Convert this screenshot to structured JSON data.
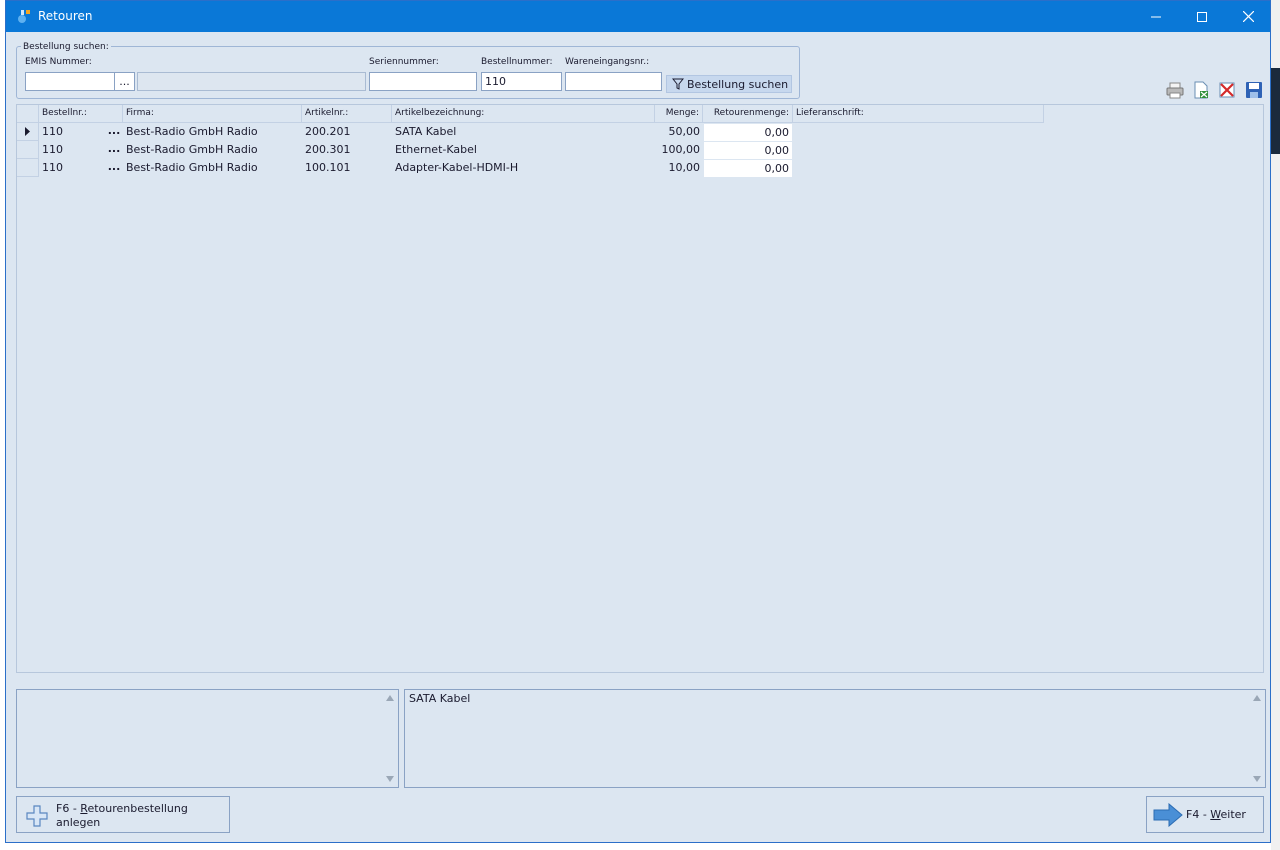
{
  "window": {
    "title": "Retouren"
  },
  "search": {
    "group_label": "Bestellung suchen:",
    "emis_label": "EMIS Nummer:",
    "emis_value": "",
    "emis_dots": "...",
    "serial_label": "Seriennummer:",
    "serial_value": "",
    "order_label": "Bestellnummer:",
    "order_value": "110",
    "goods_label": "Wareneingangsnr.:",
    "goods_value": "",
    "search_button": "Bestellung suchen"
  },
  "toolbar": {
    "icons": [
      "print-icon",
      "excel-export-icon",
      "delete-icon",
      "save-icon"
    ]
  },
  "grid": {
    "headers": {
      "order_no": "Bestellnr.:",
      "company": "Firma:",
      "article_no": "Artikelnr.:",
      "article_desc": "Artikelbezeichnung:",
      "quantity": "Menge:",
      "return_qty": "Retourenmenge:",
      "delivery": "Lieferanschrift:"
    },
    "rows": [
      {
        "order_no": "110",
        "dots": "...",
        "company": "Best-Radio GmbH Radio",
        "article_no": "200.201",
        "article_desc": "SATA Kabel",
        "quantity": "50,00",
        "return_qty": "0,00",
        "delivery": ""
      },
      {
        "order_no": "110",
        "dots": "...",
        "company": "Best-Radio GmbH Radio",
        "article_no": "200.301",
        "article_desc": "Ethernet-Kabel",
        "quantity": "100,00",
        "return_qty": "0,00",
        "delivery": ""
      },
      {
        "order_no": "110",
        "dots": "...",
        "company": "Best-Radio GmbH Radio",
        "article_no": "100.101",
        "article_desc": "Adapter-Kabel-HDMI-H",
        "quantity": "10,00",
        "return_qty": "0,00",
        "delivery": ""
      }
    ]
  },
  "memo": {
    "left_text": "",
    "right_text": "SATA Kabel"
  },
  "buttons": {
    "create_key": "F6 - ",
    "create_accel": "R",
    "create_rest": "etourenbestellung",
    "create_line2": "anlegen",
    "next_key": "F4 - ",
    "next_accel": "W",
    "next_rest": "eiter"
  }
}
